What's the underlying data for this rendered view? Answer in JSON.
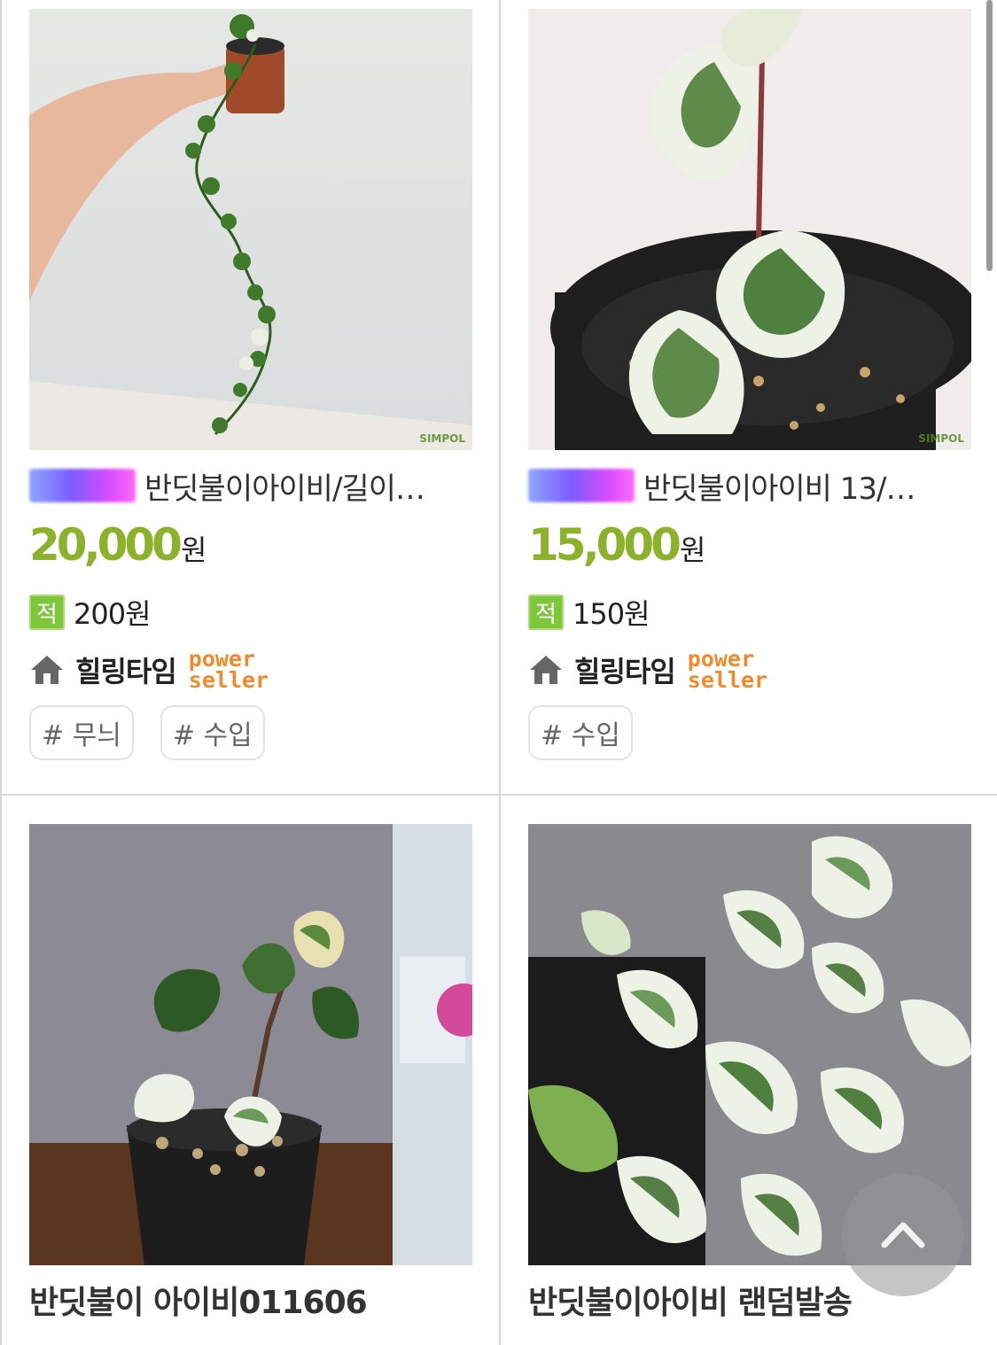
{
  "products": [
    {
      "title": "반딧불이아이비/길이…",
      "price": "20,000",
      "price_unit": "원",
      "points": "200원",
      "point_icon": "적",
      "seller": "힐링타임",
      "seller_badge": [
        "power",
        "seller"
      ],
      "tags": [
        "# 무늬",
        "# 수입"
      ],
      "watermark": "SIMPOL"
    },
    {
      "title": "반딧불이아이비 13/…",
      "price": "15,000",
      "price_unit": "원",
      "points": "150원",
      "point_icon": "적",
      "seller": "힐링타임",
      "seller_badge": [
        "power",
        "seller"
      ],
      "tags": [
        "# 수입"
      ],
      "watermark": "SIMPOL"
    },
    {
      "title": "반딧불이 아이비011606"
    },
    {
      "title": "반딧불이아이비 랜덤발송"
    }
  ],
  "colors": {
    "price": "#8cb12a",
    "power_seller": "#f08a2a",
    "point_badge": "#7ec63a"
  },
  "icons": {
    "home": "home-icon",
    "scroll_top": "chevron-up-icon"
  }
}
